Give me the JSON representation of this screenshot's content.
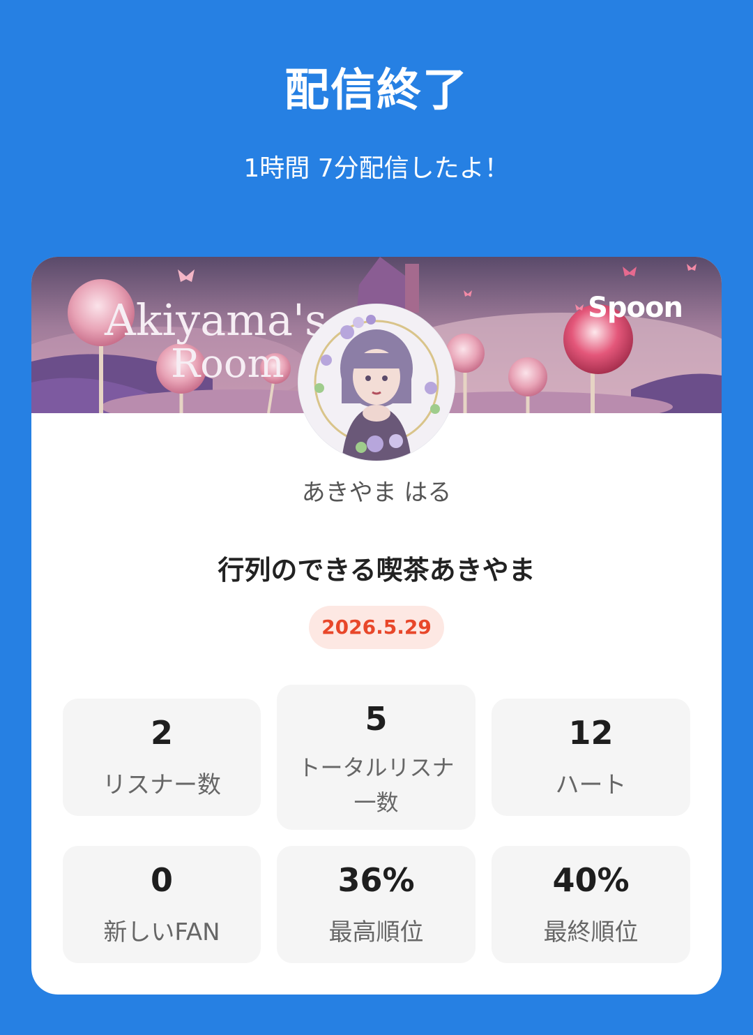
{
  "header": {
    "title": "配信終了",
    "subtitle": "1時間 7分配信したよ！"
  },
  "card": {
    "banner": {
      "text_line1": "Akiyama's",
      "text_line2": "Room",
      "brand": "Spoon"
    },
    "username": "あきやま はる",
    "room_title": "行列のできる喫茶あきやま",
    "date": "2026.5.29",
    "stats": [
      {
        "value": "2",
        "label": "リスナー数"
      },
      {
        "value": "5",
        "label": "トータルリスナ\n一数"
      },
      {
        "value": "12",
        "label": "ハート"
      },
      {
        "value": "0",
        "label": "新しいFAN"
      },
      {
        "value": "36%",
        "label": "最高順位"
      },
      {
        "value": "40%",
        "label": "最終順位"
      }
    ]
  },
  "colors": {
    "background": "#2680e3",
    "card": "#ffffff",
    "stat_box": "#f5f5f5",
    "date_badge_bg": "#fde8e3",
    "date_badge_text": "#e8472a"
  }
}
